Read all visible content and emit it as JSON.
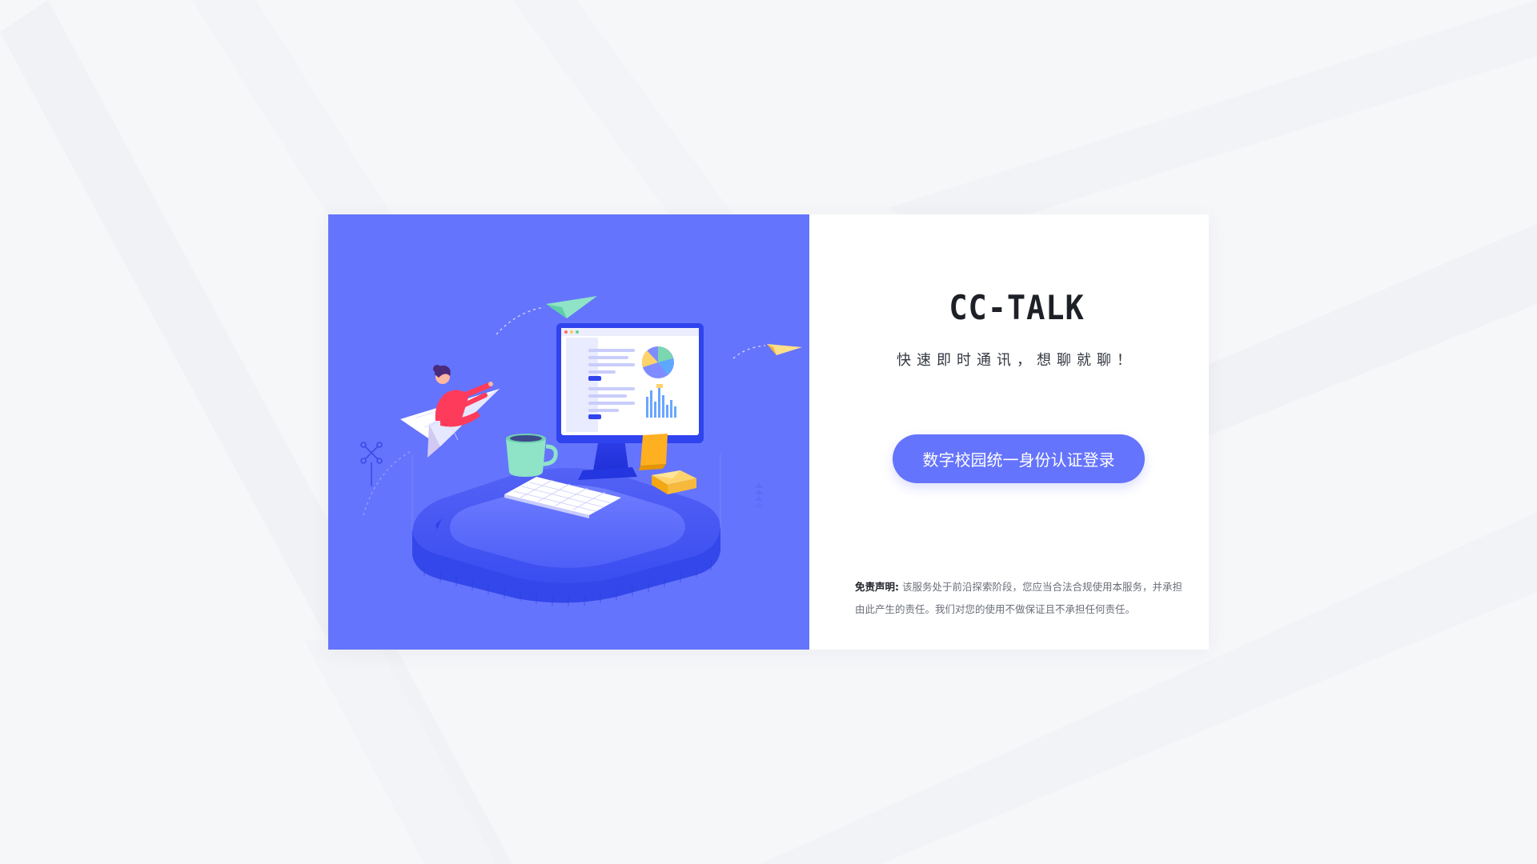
{
  "app": {
    "title": "CC-TALK",
    "slogan": "快速即时通讯，想聊就聊！"
  },
  "login": {
    "sso_button_label": "数字校园统一身份认证登录"
  },
  "disclaimer": {
    "label": "免责声明:",
    "text": " 该服务处于前沿探索阶段，您应当合法合规使用本服务，并承担由此产生的责任。我们对您的使用不做保证且不承担任何责任。"
  },
  "colors": {
    "brand": "#6574fc",
    "page_background": "#f6f7f9",
    "card_background": "#ffffff",
    "title_text": "#1e2027"
  },
  "illustration": {
    "icons": [
      "paper-plane-icon",
      "person-on-paper-plane-icon",
      "monitor-icon",
      "pie-chart-icon",
      "bar-chart-icon",
      "coffee-mug-icon",
      "keyboard-icon",
      "sticky-note-icon",
      "envelope-icon",
      "drone-icon"
    ]
  }
}
